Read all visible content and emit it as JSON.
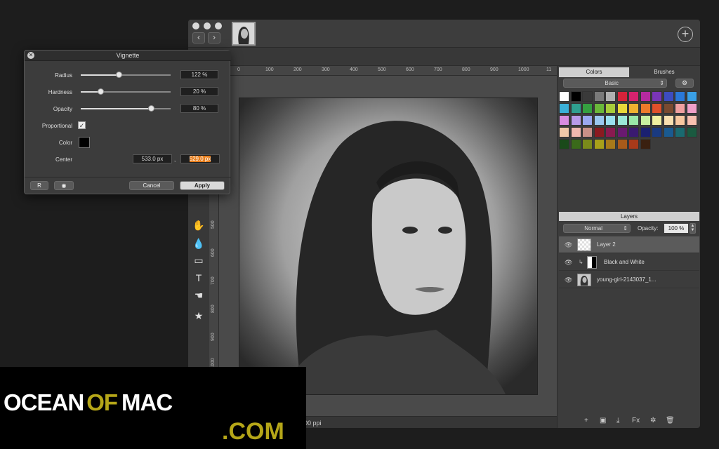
{
  "window": {
    "thumb_alt": "document thumbnail",
    "back": "‹",
    "forward": "›",
    "add": "+"
  },
  "ruler_h": [
    "0",
    "100",
    "200",
    "300",
    "400",
    "500",
    "600",
    "700",
    "800",
    "900",
    "1000",
    "11"
  ],
  "ruler_v": [
    "500",
    "600",
    "700",
    "800",
    "900",
    "1000"
  ],
  "status": {
    "text": "300 ppi"
  },
  "panel": {
    "tabs": [
      "Colors",
      "Brushes"
    ],
    "preset": "Basic",
    "swatches": [
      "#ffffff",
      "#000000",
      "#3a3a3a",
      "#7a7a7a",
      "#b0b0b0",
      "#d6233a",
      "#d6236e",
      "#b62aa0",
      "#7a35b8",
      "#3d4cc0",
      "#2a78d8",
      "#3aa0e6",
      "#3bb0d8",
      "#2fa090",
      "#35a040",
      "#6ab83a",
      "#a8cc3a",
      "#e8d83a",
      "#f0b230",
      "#ee7a2a",
      "#e0502a",
      "#7a4a30",
      "#f0a0a0",
      "#f0a0c8",
      "#d88ce0",
      "#b89ae8",
      "#9aa8f0",
      "#9ac8f0",
      "#9ae0f0",
      "#9ae8d8",
      "#9ae8a8",
      "#c8f0a0",
      "#f0f0a0",
      "#f8e0b0",
      "#f8c8a0",
      "#f8c0b0",
      "#f0c8a8",
      "#f0b8b0",
      "#c89088",
      "#8a1a20",
      "#8a1a50",
      "#6a1a70",
      "#3a1a70",
      "#1a2070",
      "#1a3a80",
      "#1a5a90",
      "#1a6a70",
      "#1a5a40",
      "#1a4a1a",
      "#3a6a1a",
      "#7a8a1a",
      "#a8a01a",
      "#a87a1a",
      "#a85a1a",
      "#a83a1a",
      "#3a2010"
    ],
    "layers_title": "Layers",
    "blend_mode": "Normal",
    "opacity_label": "Opacity:",
    "opacity_value": "100 %",
    "layers": [
      {
        "name": "Layer 2",
        "selected": true
      },
      {
        "name": "Black and White",
        "selected": false
      },
      {
        "name": "young-girl-2143037_1...",
        "selected": false
      }
    ],
    "footer": [
      "+",
      "▣",
      "⤓",
      "Fx",
      "✲",
      "🗑"
    ]
  },
  "dialog": {
    "title": "Vignette",
    "radius_label": "Radius",
    "radius_value": "122 %",
    "radius_level": 0.42,
    "hardness_label": "Hardness",
    "hardness_value": "20 %",
    "hardness_level": 0.22,
    "opacity_label": "Opacity",
    "opacity_value": "80 %",
    "opacity_level": 0.78,
    "proportional_label": "Proportional",
    "proportional_checked": "✓",
    "color_label": "Color",
    "center_label": "Center",
    "center_x": "533.0 px",
    "center_sep": ",",
    "center_y": "529.0 px",
    "reset_label": "R",
    "preview_label": "◉",
    "cancel_label": "Cancel",
    "apply_label": "Apply"
  },
  "watermark": {
    "ocean": "OCEAN",
    "of": "OF",
    "mac": "MAC",
    "com": ".COM"
  }
}
